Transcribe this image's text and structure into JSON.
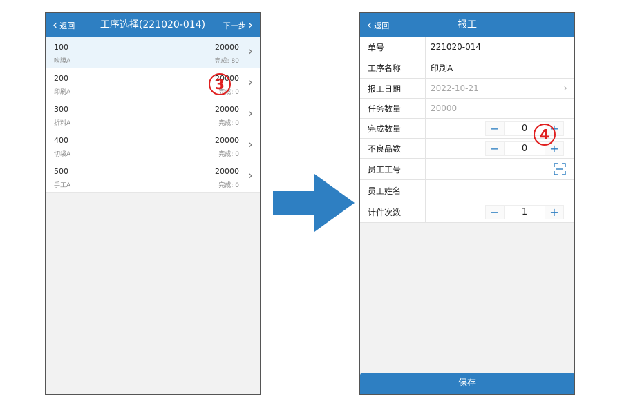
{
  "left": {
    "header": {
      "back": "返回",
      "title": "工序选择(221020-014)",
      "next": "下一步"
    },
    "items": [
      {
        "code": "100",
        "name": "吹膜A",
        "qty": "20000",
        "done": "完成: 80"
      },
      {
        "code": "200",
        "name": "印刷A",
        "qty": "20000",
        "done": "完成: 0"
      },
      {
        "code": "300",
        "name": "折料A",
        "qty": "20000",
        "done": "完成: 0"
      },
      {
        "code": "400",
        "name": "切袋A",
        "qty": "20000",
        "done": "完成: 0"
      },
      {
        "code": "500",
        "name": "手工A",
        "qty": "20000",
        "done": "完成: 0"
      }
    ],
    "badge": "3"
  },
  "right": {
    "header": {
      "back": "返回",
      "title": "报工"
    },
    "fields": {
      "order_no": {
        "label": "单号",
        "value": "221020-014"
      },
      "process": {
        "label": "工序名称",
        "value": "印刷A"
      },
      "date": {
        "label": "报工日期",
        "value": "2022-10-21"
      },
      "task_qty": {
        "label": "任务数量",
        "value": "20000"
      },
      "done_qty": {
        "label": "完成数量",
        "value": "0"
      },
      "defect_qty": {
        "label": "不良品数",
        "value": "0"
      },
      "emp_no": {
        "label": "员工工号",
        "value": ""
      },
      "emp_name": {
        "label": "员工姓名",
        "value": ""
      },
      "piece_count": {
        "label": "计件次数",
        "value": "1"
      }
    },
    "save": "保存",
    "badge": "4"
  },
  "icons": {
    "chevron_left": "‹",
    "chevron_right": "›",
    "minus": "−",
    "plus": "+"
  },
  "colors": {
    "accent": "#2e7fc2",
    "badge": "#e02020"
  }
}
